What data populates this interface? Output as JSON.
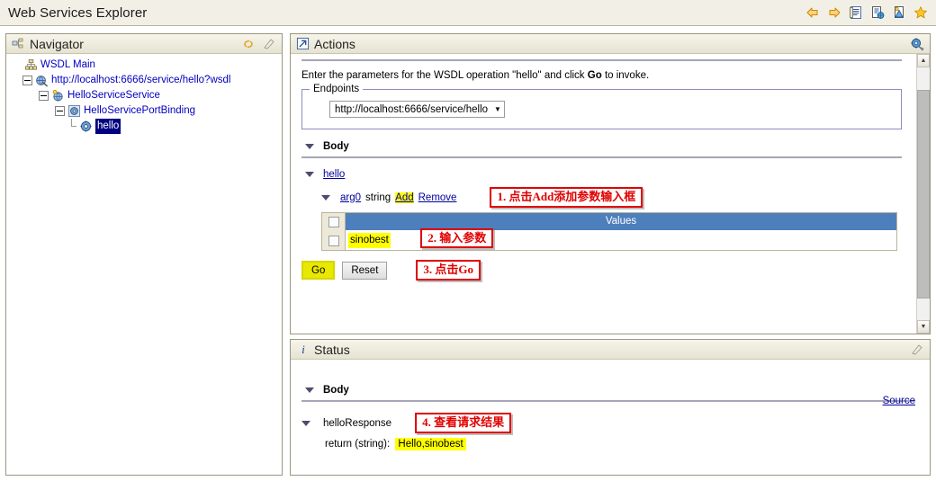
{
  "window": {
    "title": "Web Services Explorer",
    "toolbar": [
      {
        "name": "back-icon",
        "label": "Back"
      },
      {
        "name": "forward-icon",
        "label": "Forward"
      },
      {
        "name": "properties-icon",
        "label": "Properties"
      },
      {
        "name": "wsdl-page-icon",
        "label": "WSDL Page"
      },
      {
        "name": "wsil-page-icon",
        "label": "WSIL Page"
      },
      {
        "name": "favorites-icon",
        "label": "Favorites"
      }
    ]
  },
  "navigator": {
    "title": "Navigator",
    "header_icon": "navigator-icon",
    "tools": [
      {
        "name": "link-with-editor-icon",
        "label": "Link"
      },
      {
        "name": "maximize-icon",
        "label": "Maximize"
      }
    ],
    "tree": [
      {
        "label": "WSDL Main",
        "icon": "wsdl-main-icon",
        "depth": 0,
        "expander": "none",
        "selected": false
      },
      {
        "label": "http://localhost:6666/service/hello?wsdl",
        "icon": "wsdl-service-icon",
        "depth": 1,
        "expander": "expanded",
        "selected": false
      },
      {
        "label": "HelloServiceService",
        "icon": "service-icon",
        "depth": 2,
        "expander": "expanded",
        "selected": false
      },
      {
        "label": "HelloServicePortBinding",
        "icon": "binding-icon",
        "depth": 3,
        "expander": "expanded",
        "selected": false
      },
      {
        "label": "hello",
        "icon": "operation-icon",
        "depth": 4,
        "expander": "leaf",
        "selected": true
      }
    ]
  },
  "actions": {
    "title": "Actions",
    "header_icon": "actions-icon",
    "tools": [
      {
        "name": "show-forms-icon",
        "label": "Show Form"
      }
    ],
    "intro_before": "Enter the parameters for the WSDL operation \"hello\" and click ",
    "intro_bold": "Go",
    "intro_after": " to invoke.",
    "endpoints": {
      "legend": "Endpoints",
      "selected": "http://localhost:6666/service/hello",
      "options": [
        "http://localhost:6666/service/hello"
      ]
    },
    "body_section": "Body",
    "operation": "hello",
    "argument": {
      "name": "arg0",
      "type": "string",
      "add_label": "Add",
      "remove_label": "Remove"
    },
    "values_table": {
      "column_header": "Values",
      "rows": [
        {
          "value": "sinobest"
        }
      ]
    },
    "buttons": {
      "go": "Go",
      "reset": "Reset"
    },
    "annotations": [
      {
        "id": "step1",
        "text": "1. 点击Add添加参数输入框"
      },
      {
        "id": "step2",
        "text": "2. 输入参数"
      },
      {
        "id": "step3",
        "text": "3. 点击Go"
      }
    ]
  },
  "status": {
    "title": "Status",
    "header_icon": "info-icon",
    "tools": [
      {
        "name": "maximize-icon",
        "label": "Maximize"
      }
    ],
    "source_link": "Source",
    "body_section": "Body",
    "response_node": "helloResponse",
    "return_label": "return (string):",
    "return_value": "Hello,sinobest",
    "annotations": [
      {
        "id": "step4",
        "text": "4. 查看请求结果"
      }
    ]
  },
  "colors": {
    "titlebar_bg": "#f2f0e6",
    "view_header_bg": "#eceadb",
    "table_header_blue": "#4d7fbc",
    "highlight_yellow": "#ffff00",
    "annotation_red": "#e00000",
    "link_blue": "#00009e",
    "tree_text_blue": "#0000c0",
    "selection_navy": "#000080",
    "go_button": "#e8e800"
  }
}
